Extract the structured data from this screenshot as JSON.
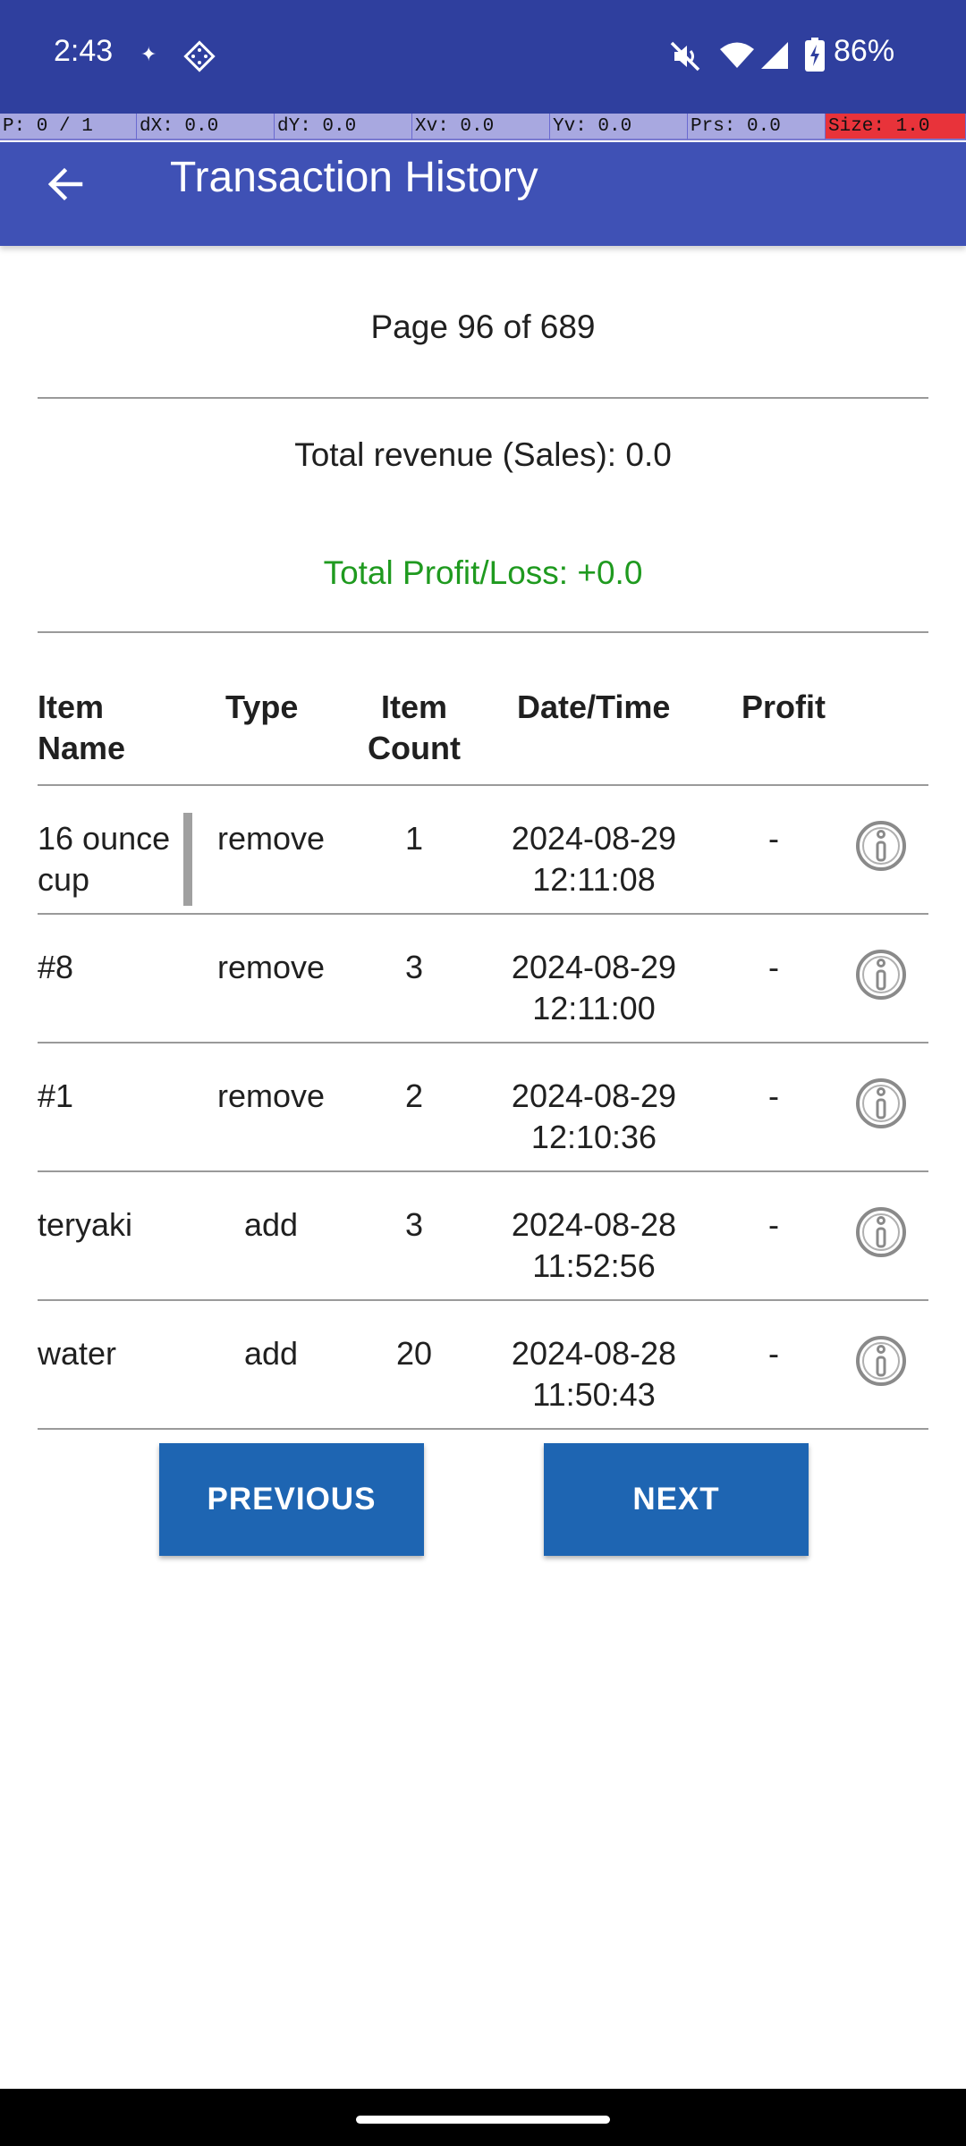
{
  "status_bar": {
    "time": "2:43",
    "battery_percent": "86%",
    "icons": [
      "sparkle-icon",
      "diamond-app-icon",
      "mute-icon",
      "wifi-icon",
      "signal-icon",
      "battery-charging-icon"
    ]
  },
  "debug_overlay": {
    "p": "P: 0 / 1",
    "dx": "dX: 0.0",
    "dy": "dY: 0.0",
    "xv": "Xv: 0.0",
    "yv": "Yv: 0.0",
    "prs": "Prs: 0.0",
    "size": "Size: 1.0"
  },
  "app_bar": {
    "title": "Transaction History",
    "back_icon": "arrow-back-icon"
  },
  "summary": {
    "page_indicator": "Page 96 of 689",
    "total_revenue": "Total revenue (Sales): 0.0",
    "total_profit_loss": "Total Profit/Loss: +0.0",
    "profit_color": "#1f9a1f"
  },
  "table": {
    "headers": {
      "item_name_1": "Item",
      "item_name_2": "Name",
      "type": "Type",
      "item_count_1": "Item",
      "item_count_2": "Count",
      "date_time": "Date/Time",
      "profit": "Profit"
    },
    "rows": [
      {
        "name_1": "16 ounce",
        "name_2": "cup",
        "type": "remove",
        "count": "1",
        "date": "2024-08-29",
        "time": "12:11:08",
        "profit": "-"
      },
      {
        "name_1": "#8",
        "name_2": "",
        "type": "remove",
        "count": "3",
        "date": "2024-08-29",
        "time": "12:11:00",
        "profit": "-"
      },
      {
        "name_1": "#1",
        "name_2": "",
        "type": "remove",
        "count": "2",
        "date": "2024-08-29",
        "time": "12:10:36",
        "profit": "-"
      },
      {
        "name_1": "teryaki",
        "name_2": "",
        "type": "add",
        "count": "3",
        "date": "2024-08-28",
        "time": "11:52:56",
        "profit": "-"
      },
      {
        "name_1": "water",
        "name_2": "",
        "type": "add",
        "count": "20",
        "date": "2024-08-28",
        "time": "11:50:43",
        "profit": "-"
      }
    ]
  },
  "pagination": {
    "previous_label": "PREVIOUS",
    "next_label": "NEXT"
  },
  "colors": {
    "status_bar": "#2f3f9e",
    "app_bar": "#3f51b5",
    "button": "#1e65b2"
  }
}
